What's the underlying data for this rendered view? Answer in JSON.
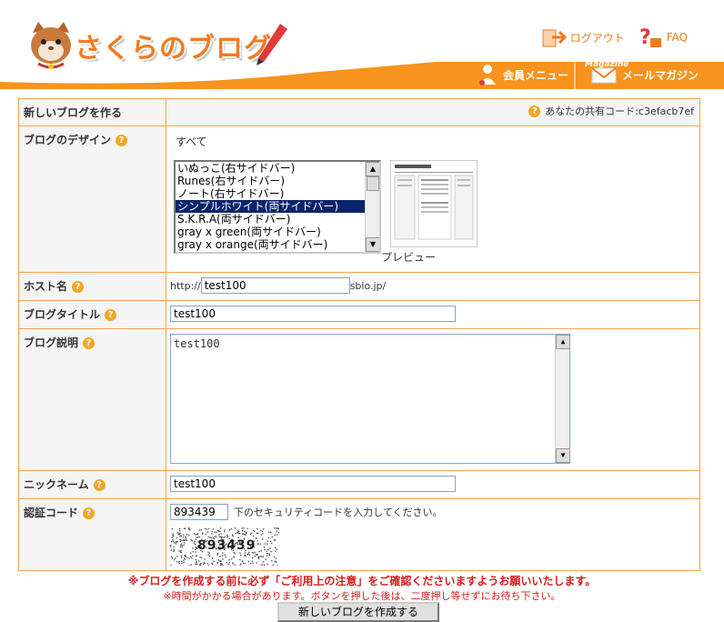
{
  "header": {
    "logo_text": "さくらのブログ",
    "logout_label": "ログアウト",
    "faq_label": "FAQ",
    "member_menu_label": "会員メニュー",
    "magazine_badge": "Magazine",
    "mail_magazine_label": "メールマガジン"
  },
  "form": {
    "new_blog_label": "新しいブログを作る",
    "share_code_text": "あなたの共有コード:c3efacb7ef",
    "design": {
      "label": "ブログのデザイン",
      "category": "すべて",
      "options": [
        "いぬっこ(右サイドバー)",
        "Runes(右サイドバー)",
        "ノート(右サイドバー)",
        "シンプルホワイト(両サイドバー)",
        "S.K.R.A(両サイドバー)",
        "gray x green(両サイドバー)",
        "gray x orange(両サイドバー)"
      ],
      "selected_index": 3,
      "preview_label": "プレビュー"
    },
    "host": {
      "label": "ホスト名",
      "prefix": "http://",
      "value": "test100",
      "suffix": "sblo.jp/"
    },
    "title": {
      "label": "ブログタイトル",
      "value": "test100"
    },
    "description": {
      "label": "ブログ説明",
      "value": "test100"
    },
    "nickname": {
      "label": "ニックネーム",
      "value": "test100"
    },
    "auth": {
      "label": "認証コード",
      "value": "893439",
      "hint": "下のセキュリティコードを入力してください。",
      "captcha_text": "893439"
    }
  },
  "notice": {
    "line1": "※ブログを作成する前に必ず「ご利用上の注意」をご確認くださいますようお願いいたします。",
    "line2": "※時間がかかる場合があります。ボタンを押した後は、二度押し等せずにお待ち下さい。"
  },
  "submit_label": "新しいブログを作成する",
  "colors": {
    "accent": "#f7931e",
    "border": "#f3a452",
    "notice": "#d81c1c"
  }
}
